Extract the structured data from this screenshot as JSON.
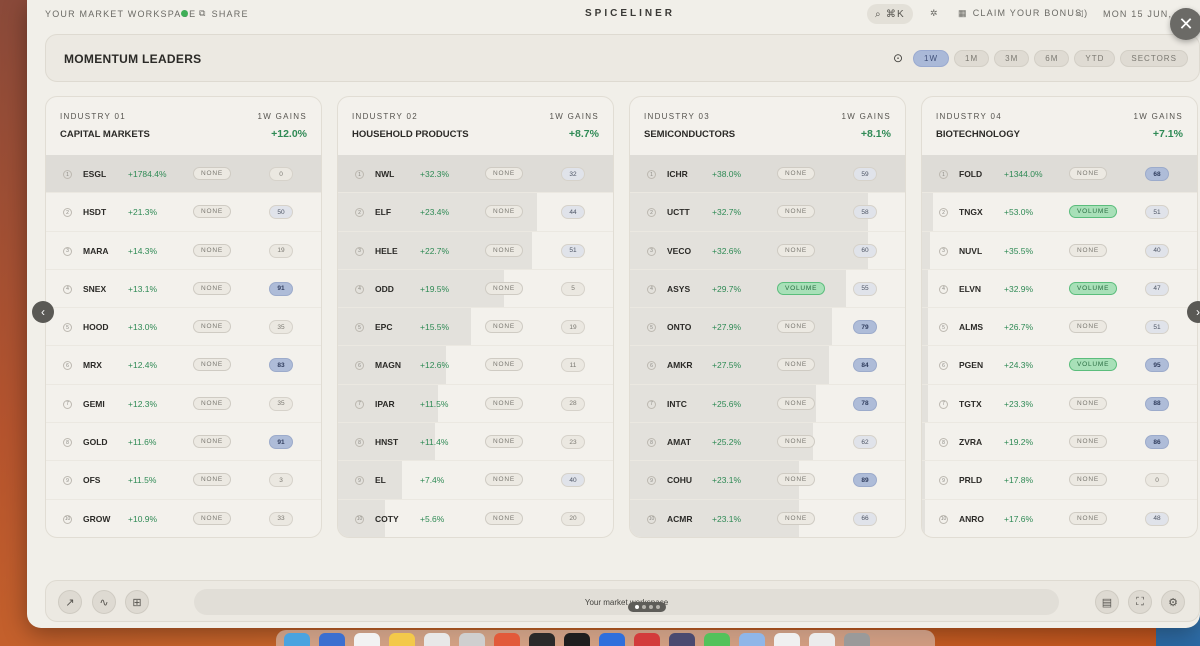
{
  "topbar": {
    "workspace": "YOUR MARKET WORKSPACE",
    "share": "SHARE",
    "brand": "SPICELINER",
    "search_shortcut": "⌘K",
    "bonus": "CLAIM YOUR BONUS",
    "date": "MON 15 JUN, 1..."
  },
  "header": {
    "title": "MOMENTUM LEADERS",
    "ranges": [
      "1W",
      "1M",
      "3M",
      "6M",
      "YTD",
      "SECTORS"
    ],
    "active_range": "1W"
  },
  "industries": [
    {
      "label": "INDUSTRY 01",
      "name": "CAPITAL MARKETS",
      "gains_label": "1W GAINS",
      "gain": "+12.0%",
      "rows": [
        {
          "rank": "1",
          "ticker": "ESGL",
          "change": "+1784.4%",
          "signal": "NONE",
          "score": "0",
          "level": "low",
          "bar": 1.0
        },
        {
          "rank": "2",
          "ticker": "HSDT",
          "change": "+21.3%",
          "signal": "NONE",
          "score": "50",
          "level": "med",
          "bar": 0
        },
        {
          "rank": "3",
          "ticker": "MARA",
          "change": "+14.3%",
          "signal": "NONE",
          "score": "19",
          "level": "low",
          "bar": 0
        },
        {
          "rank": "4",
          "ticker": "SNEX",
          "change": "+13.1%",
          "signal": "NONE",
          "score": "91",
          "level": "high",
          "bar": 0
        },
        {
          "rank": "5",
          "ticker": "HOOD",
          "change": "+13.0%",
          "signal": "NONE",
          "score": "35",
          "level": "low",
          "bar": 0
        },
        {
          "rank": "6",
          "ticker": "MRX",
          "change": "+12.4%",
          "signal": "NONE",
          "score": "83",
          "level": "high",
          "bar": 0
        },
        {
          "rank": "7",
          "ticker": "GEMI",
          "change": "+12.3%",
          "signal": "NONE",
          "score": "35",
          "level": "low",
          "bar": 0
        },
        {
          "rank": "8",
          "ticker": "GOLD",
          "change": "+11.6%",
          "signal": "NONE",
          "score": "91",
          "level": "high",
          "bar": 0
        },
        {
          "rank": "9",
          "ticker": "OFS",
          "change": "+11.5%",
          "signal": "NONE",
          "score": "3",
          "level": "low",
          "bar": 0
        },
        {
          "rank": "10",
          "ticker": "GROW",
          "change": "+10.9%",
          "signal": "NONE",
          "score": "33",
          "level": "low",
          "bar": 0
        }
      ]
    },
    {
      "label": "INDUSTRY 02",
      "name": "HOUSEHOLD PRODUCTS",
      "gains_label": "1W GAINS",
      "gain": "+8.7%",
      "rows": [
        {
          "rank": "1",
          "ticker": "NWL",
          "change": "+32.3%",
          "signal": "NONE",
          "score": "32",
          "level": "med",
          "bar": 1.0
        },
        {
          "rank": "2",
          "ticker": "ELF",
          "change": "+23.4%",
          "signal": "NONE",
          "score": "44",
          "level": "med",
          "bar": 0.72
        },
        {
          "rank": "3",
          "ticker": "HELE",
          "change": "+22.7%",
          "signal": "NONE",
          "score": "51",
          "level": "med",
          "bar": 0.7
        },
        {
          "rank": "4",
          "ticker": "ODD",
          "change": "+19.5%",
          "signal": "NONE",
          "score": "5",
          "level": "low",
          "bar": 0.6
        },
        {
          "rank": "5",
          "ticker": "EPC",
          "change": "+15.5%",
          "signal": "NONE",
          "score": "19",
          "level": "low",
          "bar": 0.48
        },
        {
          "rank": "6",
          "ticker": "MAGN",
          "change": "+12.6%",
          "signal": "NONE",
          "score": "11",
          "level": "low",
          "bar": 0.39
        },
        {
          "rank": "7",
          "ticker": "IPAR",
          "change": "+11.5%",
          "signal": "NONE",
          "score": "28",
          "level": "low",
          "bar": 0.36
        },
        {
          "rank": "8",
          "ticker": "HNST",
          "change": "+11.4%",
          "signal": "NONE",
          "score": "23",
          "level": "low",
          "bar": 0.35
        },
        {
          "rank": "9",
          "ticker": "EL",
          "change": "+7.4%",
          "signal": "NONE",
          "score": "40",
          "level": "med",
          "bar": 0.23
        },
        {
          "rank": "10",
          "ticker": "COTY",
          "change": "+5.6%",
          "signal": "NONE",
          "score": "20",
          "level": "low",
          "bar": 0.17
        }
      ]
    },
    {
      "label": "INDUSTRY 03",
      "name": "SEMICONDUCTORS",
      "gains_label": "1W GAINS",
      "gain": "+8.1%",
      "rows": [
        {
          "rank": "1",
          "ticker": "ICHR",
          "change": "+38.0%",
          "signal": "NONE",
          "score": "59",
          "level": "med",
          "bar": 1.0
        },
        {
          "rank": "2",
          "ticker": "UCTT",
          "change": "+32.7%",
          "signal": "NONE",
          "score": "58",
          "level": "med",
          "bar": 0.86
        },
        {
          "rank": "3",
          "ticker": "VECO",
          "change": "+32.6%",
          "signal": "NONE",
          "score": "60",
          "level": "med",
          "bar": 0.86
        },
        {
          "rank": "4",
          "ticker": "ASYS",
          "change": "+29.7%",
          "signal": "VOLUME",
          "score": "55",
          "level": "med",
          "bar": 0.78
        },
        {
          "rank": "5",
          "ticker": "ONTO",
          "change": "+27.9%",
          "signal": "NONE",
          "score": "79",
          "level": "high",
          "bar": 0.73
        },
        {
          "rank": "6",
          "ticker": "AMKR",
          "change": "+27.5%",
          "signal": "NONE",
          "score": "84",
          "level": "high",
          "bar": 0.72
        },
        {
          "rank": "7",
          "ticker": "INTC",
          "change": "+25.6%",
          "signal": "NONE",
          "score": "78",
          "level": "high",
          "bar": 0.67
        },
        {
          "rank": "8",
          "ticker": "AMAT",
          "change": "+25.2%",
          "signal": "NONE",
          "score": "62",
          "level": "med",
          "bar": 0.66
        },
        {
          "rank": "9",
          "ticker": "COHU",
          "change": "+23.1%",
          "signal": "NONE",
          "score": "89",
          "level": "high",
          "bar": 0.61
        },
        {
          "rank": "10",
          "ticker": "ACMR",
          "change": "+23.1%",
          "signal": "NONE",
          "score": "66",
          "level": "med",
          "bar": 0.61
        }
      ]
    },
    {
      "label": "INDUSTRY 04",
      "name": "BIOTECHNOLOGY",
      "gains_label": "1W GAINS",
      "gain": "+7.1%",
      "rows": [
        {
          "rank": "1",
          "ticker": "FOLD",
          "change": "+1344.0%",
          "signal": "NONE",
          "score": "68",
          "level": "high",
          "bar": 1.0
        },
        {
          "rank": "2",
          "ticker": "TNGX",
          "change": "+53.0%",
          "signal": "VOLUME",
          "score": "51",
          "level": "med",
          "bar": 0.04
        },
        {
          "rank": "3",
          "ticker": "NUVL",
          "change": "+35.5%",
          "signal": "NONE",
          "score": "40",
          "level": "med",
          "bar": 0.03
        },
        {
          "rank": "4",
          "ticker": "ELVN",
          "change": "+32.9%",
          "signal": "VOLUME",
          "score": "47",
          "level": "med",
          "bar": 0.02
        },
        {
          "rank": "5",
          "ticker": "ALMS",
          "change": "+26.7%",
          "signal": "NONE",
          "score": "51",
          "level": "med",
          "bar": 0.02
        },
        {
          "rank": "6",
          "ticker": "PGEN",
          "change": "+24.3%",
          "signal": "VOLUME",
          "score": "95",
          "level": "high",
          "bar": 0.02
        },
        {
          "rank": "7",
          "ticker": "TGTX",
          "change": "+23.3%",
          "signal": "NONE",
          "score": "88",
          "level": "high",
          "bar": 0.02
        },
        {
          "rank": "8",
          "ticker": "ZVRA",
          "change": "+19.2%",
          "signal": "NONE",
          "score": "86",
          "level": "high",
          "bar": 0.01
        },
        {
          "rank": "9",
          "ticker": "PRLD",
          "change": "+17.8%",
          "signal": "NONE",
          "score": "0",
          "level": "low",
          "bar": 0.01
        },
        {
          "rank": "10",
          "ticker": "ANRO",
          "change": "+17.6%",
          "signal": "NONE",
          "score": "48",
          "level": "med",
          "bar": 0.01
        }
      ]
    }
  ],
  "bottom": {
    "pill_text": "Your market workspace"
  },
  "colors": {
    "gain": "#2f8a55",
    "volume": "#a8e0b8",
    "active_tab": "#aab9d8",
    "score_high": "#aebcd8"
  },
  "icons": {
    "left_buttons": [
      "trend-icon",
      "pulse-icon",
      "grid-icon"
    ],
    "right_buttons": [
      "layout-icon",
      "fullscreen-icon",
      "settings-icon"
    ]
  }
}
